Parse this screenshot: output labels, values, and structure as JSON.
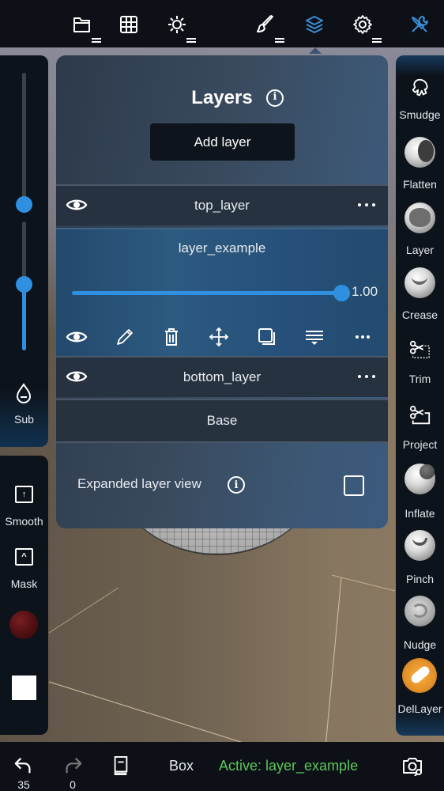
{
  "topbar": {
    "icons": [
      {
        "name": "folder-icon",
        "has_menu": true
      },
      {
        "name": "grid-icon",
        "has_menu": false
      },
      {
        "name": "sun-icon",
        "has_menu": true
      },
      {
        "name": "brush-icon",
        "has_menu": true
      },
      {
        "name": "layers-icon",
        "has_menu": false,
        "active": true
      },
      {
        "name": "gear-icon",
        "has_menu": true
      },
      {
        "name": "tools-icon",
        "has_menu": false,
        "active": true
      }
    ],
    "accent_color": "#3a8fd8"
  },
  "left_panel": {
    "radius_slider": {
      "value": 0.0
    },
    "intensity_slider": {
      "value": 0.55
    },
    "sub_label": "Sub",
    "smooth_label": "Smooth",
    "mask_label": "Mask",
    "material_color": "#5a1216",
    "paint_color": "#ffffff"
  },
  "layers_panel": {
    "title": "Layers",
    "add_layer_label": "Add layer",
    "layers": [
      {
        "name": "top_layer",
        "visible": true
      },
      {
        "name": "layer_example",
        "visible": true,
        "active": true,
        "opacity": 1.0,
        "opacity_label": "1.00"
      },
      {
        "name": "bottom_layer",
        "visible": true
      }
    ],
    "base_label": "Base",
    "expanded_view_label": "Expanded layer view",
    "expanded_view_checked": false
  },
  "right_panel": {
    "tools": [
      {
        "label": "Smudge",
        "icon": "smudge-icon"
      },
      {
        "label": "Flatten",
        "icon": "flatten-icon"
      },
      {
        "label": "Layer",
        "icon": "layer-brush-icon"
      },
      {
        "label": "Crease",
        "icon": "crease-icon"
      },
      {
        "label": "Trim",
        "icon": "trim-icon"
      },
      {
        "label": "Project",
        "icon": "project-icon"
      },
      {
        "label": "Inflate",
        "icon": "inflate-icon"
      },
      {
        "label": "Pinch",
        "icon": "pinch-icon"
      },
      {
        "label": "Nudge",
        "icon": "nudge-icon"
      },
      {
        "label": "DelLayer",
        "icon": "dellayer-icon"
      }
    ]
  },
  "bottombar": {
    "undo_count": "35",
    "redo_count": "0",
    "primitive_label": "Box",
    "status_text": "Active: layer_example",
    "status_color": "#5cc85c"
  }
}
